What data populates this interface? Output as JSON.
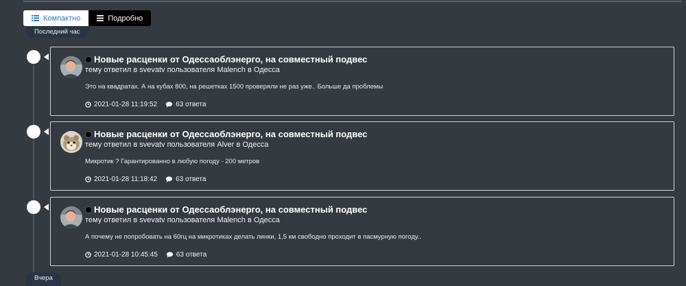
{
  "view_toggle": {
    "compact_label": "Компактно",
    "detailed_label": "Подробно"
  },
  "periods": {
    "last_hour": "Последний час",
    "yesterday": "Вчера"
  },
  "entries": [
    {
      "title": "Новые расценки от Одессаоблэнерго, на совместный подвес",
      "action": "тему ответил в",
      "forum": "svevatv",
      "user_prefix": "пользователя",
      "user": "Malench",
      "loc_prefix": "в",
      "location": "Одесса",
      "excerpt": "Это на квадратах. А на кубах 800, на решетках 1500 проверяли не раз уже.. Больше да проблемы",
      "timestamp": "2021-01-28 11:19:52",
      "replies": "63 ответа",
      "avatar_icon": "person-avatar-icon"
    },
    {
      "title": "Новые расценки от Одессаоблэнерго, на совместный подвес",
      "action": "тему ответил в",
      "forum": "svevatv",
      "user_prefix": "пользователя",
      "user": "Alver",
      "loc_prefix": "в",
      "location": "Одесса",
      "excerpt": "Микротик ? Гарантированно в любую погоду - 200 метров",
      "timestamp": "2021-01-28 11:18:42",
      "replies": "63 ответа",
      "avatar_icon": "hamster-avatar-icon"
    },
    {
      "title": "Новые расценки от Одессаоблэнерго, на совместный подвес",
      "action": "тему ответил в",
      "forum": "svevatv",
      "user_prefix": "пользователя",
      "user": "Malench",
      "loc_prefix": "в",
      "location": "Одесса",
      "excerpt": "А почему не попробовать на 60гц на микротиках делать линки, 1,5 км свободно проходит в пасмурную погоду..",
      "timestamp": "2021-01-28 10:45:45",
      "replies": "63 ответа",
      "avatar_icon": "person-avatar-icon"
    }
  ],
  "colors": {
    "background": "#343a40",
    "active_toggle_text": "#337ab7",
    "badge_bg": "#2a3442"
  }
}
